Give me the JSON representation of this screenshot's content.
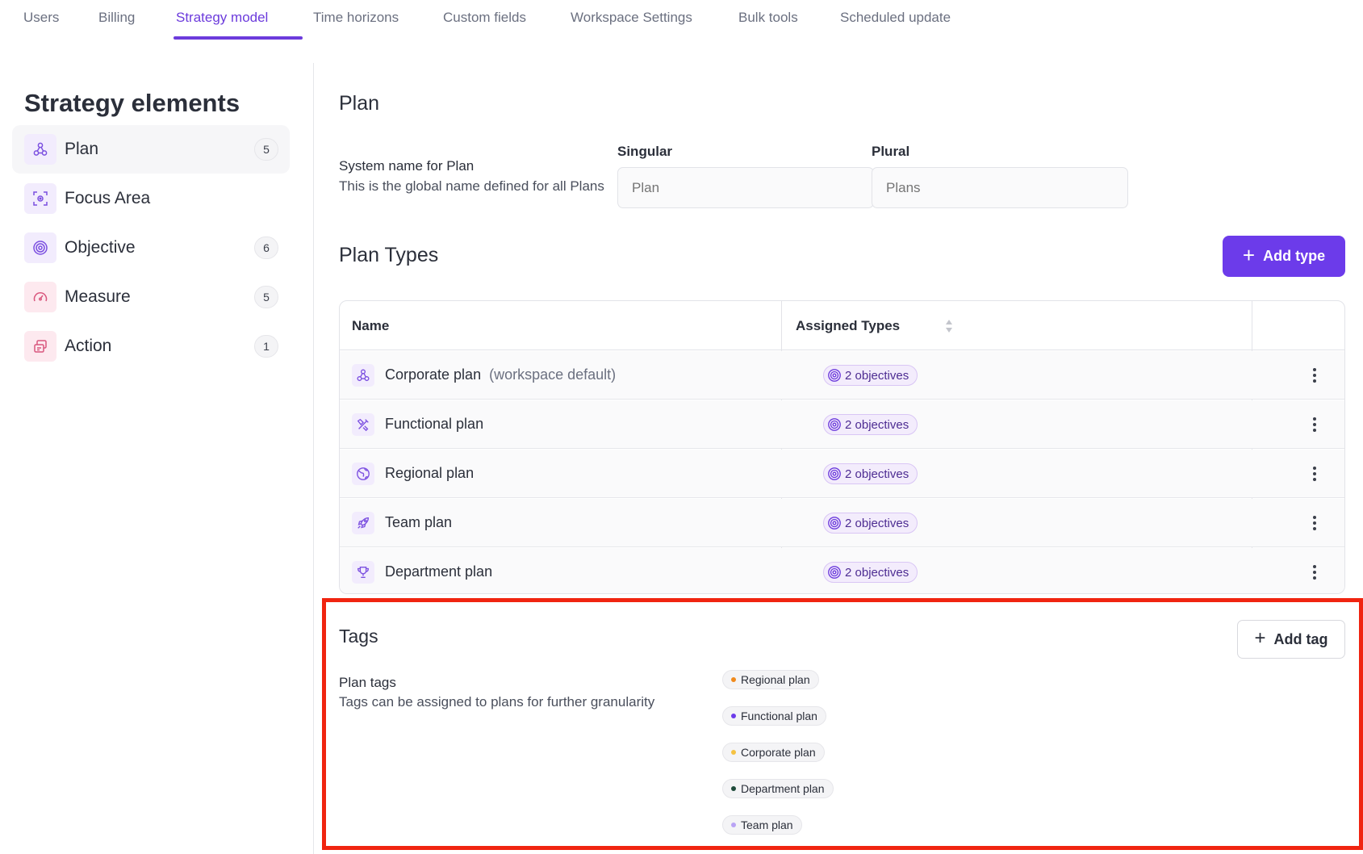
{
  "tabs": [
    {
      "label": "Users"
    },
    {
      "label": "Billing"
    },
    {
      "label": "Strategy model",
      "active": true
    },
    {
      "label": "Time horizons"
    },
    {
      "label": "Custom fields"
    },
    {
      "label": "Workspace Settings"
    },
    {
      "label": "Bulk tools"
    },
    {
      "label": "Scheduled update"
    }
  ],
  "sidebar": {
    "title": "Strategy elements",
    "items": [
      {
        "label": "Plan",
        "count": "5",
        "icon": "plan-icon",
        "active": true
      },
      {
        "label": "Focus Area",
        "count": "",
        "icon": "focus-icon"
      },
      {
        "label": "Objective",
        "count": "6",
        "icon": "objective-icon"
      },
      {
        "label": "Measure",
        "count": "5",
        "icon": "gauge-icon"
      },
      {
        "label": "Action",
        "count": "1",
        "icon": "action-icon"
      }
    ]
  },
  "plan": {
    "heading": "Plan",
    "system_title": "System name for Plan",
    "system_desc": "This is the global name defined for all Plans",
    "singular_label": "Singular",
    "singular_placeholder": "Plan",
    "plural_label": "Plural",
    "plural_placeholder": "Plans"
  },
  "plan_types": {
    "heading": "Plan Types",
    "add_label": "Add type",
    "columns": [
      "Name",
      "Assigned Types"
    ],
    "rows": [
      {
        "name": "Corporate plan",
        "suffix": "(workspace default)",
        "assigned": "2 objectives",
        "icon": "plan-icon"
      },
      {
        "name": "Functional plan",
        "suffix": "",
        "assigned": "2 objectives",
        "icon": "tools-icon"
      },
      {
        "name": "Regional plan",
        "suffix": "",
        "assigned": "2 objectives",
        "icon": "globe-icon"
      },
      {
        "name": "Team plan",
        "suffix": "",
        "assigned": "2 objectives",
        "icon": "rocket-icon"
      },
      {
        "name": "Department plan",
        "suffix": "",
        "assigned": "2 objectives",
        "icon": "trophy-icon"
      }
    ]
  },
  "tags": {
    "heading": "Tags",
    "add_label": "Add tag",
    "title": "Plan tags",
    "desc": "Tags can be assigned to plans for further granularity",
    "items": [
      {
        "label": "Regional plan",
        "color": "#f08a1c"
      },
      {
        "label": "Functional plan",
        "color": "#6c3bea"
      },
      {
        "label": "Corporate plan",
        "color": "#f5c242"
      },
      {
        "label": "Department plan",
        "color": "#1e4a3a"
      },
      {
        "label": "Team plan",
        "color": "#b9a3f5"
      }
    ]
  },
  "colors": {
    "accent": "#6c3bea",
    "highlight_border": "#f02410"
  }
}
